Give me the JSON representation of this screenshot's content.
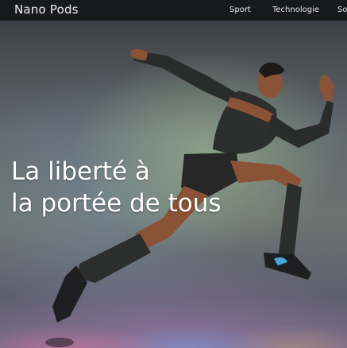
{
  "header": {
    "brand": "Nano Pods",
    "nav": [
      {
        "label": "Sport"
      },
      {
        "label": "Technologie"
      },
      {
        "label": "So"
      }
    ]
  },
  "hero": {
    "headline_line1": "La liberté à",
    "headline_line2": "la portée de tous",
    "image": "sprinter-athlete-photo"
  },
  "colors": {
    "topbar": "#18191c",
    "text": "#ffffff",
    "suit": "#2b2c2b",
    "skin": "#8a5236"
  }
}
